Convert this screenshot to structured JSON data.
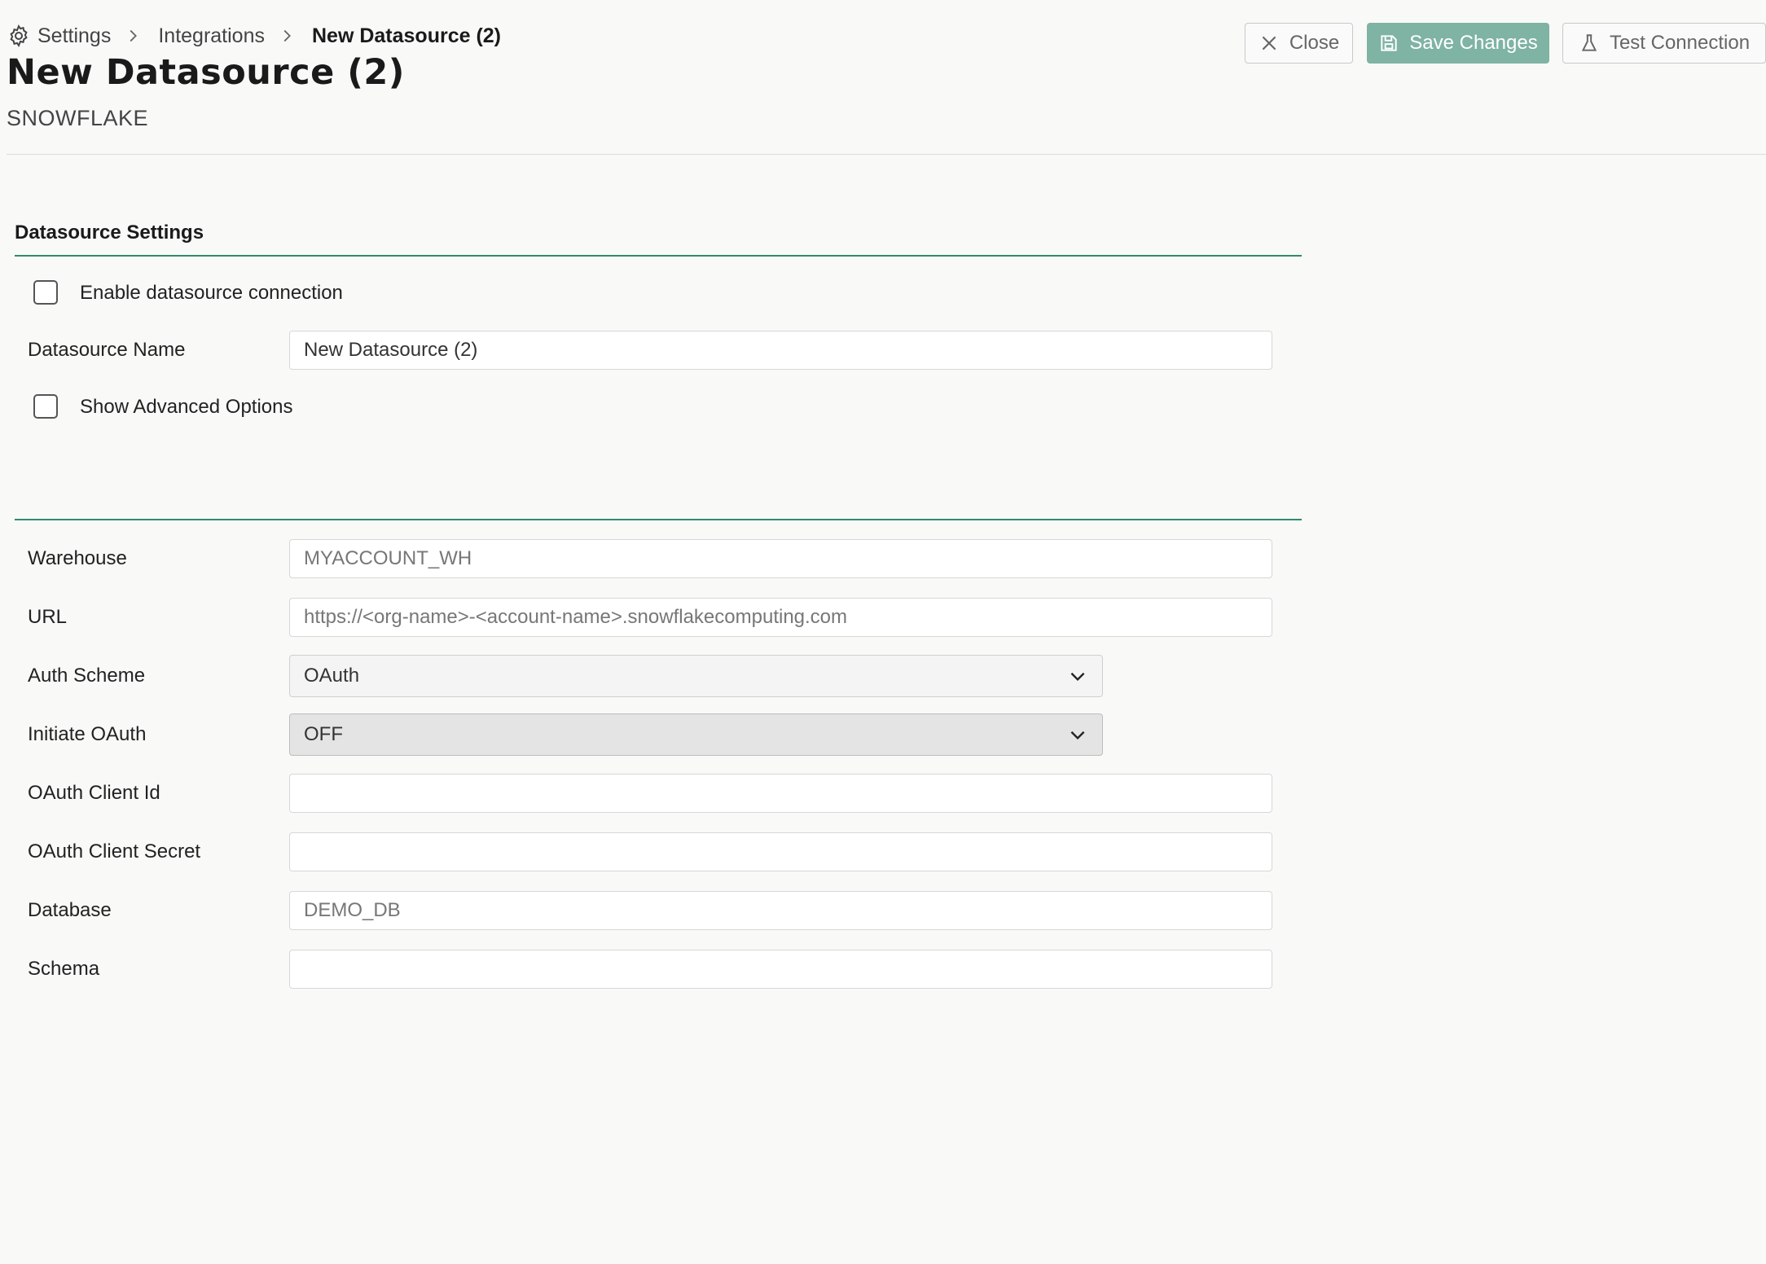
{
  "breadcrumb": {
    "icon": "gear-icon",
    "items": [
      "Settings",
      "Integrations",
      "New Datasource (2)"
    ]
  },
  "header": {
    "title": "New Datasource (2)",
    "subtitle": "SNOWFLAKE",
    "buttons": {
      "close": {
        "label": "Close",
        "icon": "close-icon"
      },
      "save": {
        "label": "Save Changes",
        "icon": "save-icon"
      },
      "test": {
        "label": "Test Connection",
        "icon": "flask-icon"
      }
    }
  },
  "section": {
    "title": "Datasource Settings"
  },
  "checkboxes": {
    "enable": {
      "label": "Enable datasource connection",
      "checked": false
    },
    "advanced": {
      "label": "Show Advanced Options",
      "checked": false
    }
  },
  "fields": {
    "datasource_name": {
      "label": "Datasource Name",
      "value": "New Datasource (2)",
      "placeholder": ""
    },
    "warehouse": {
      "label": "Warehouse",
      "value": "",
      "placeholder": "MYACCOUNT_WH"
    },
    "url": {
      "label": "URL",
      "value": "",
      "placeholder": "https://<org-name>-<account-name>.snowflakecomputing.com"
    },
    "auth_scheme": {
      "label": "Auth Scheme",
      "value": "OAuth"
    },
    "initiate_oauth": {
      "label": "Initiate OAuth",
      "value": "OFF"
    },
    "oauth_client_id": {
      "label": "OAuth Client Id",
      "value": "",
      "placeholder": ""
    },
    "oauth_client_secret": {
      "label": "OAuth Client Secret",
      "value": "",
      "placeholder": ""
    },
    "database": {
      "label": "Database",
      "value": "",
      "placeholder": "DEMO_DB"
    },
    "schema": {
      "label": "Schema",
      "value": "",
      "placeholder": ""
    }
  },
  "colors": {
    "accent": "#2f8a6e",
    "save_button": "#7fb3a4",
    "background": "#f9f9f8"
  }
}
